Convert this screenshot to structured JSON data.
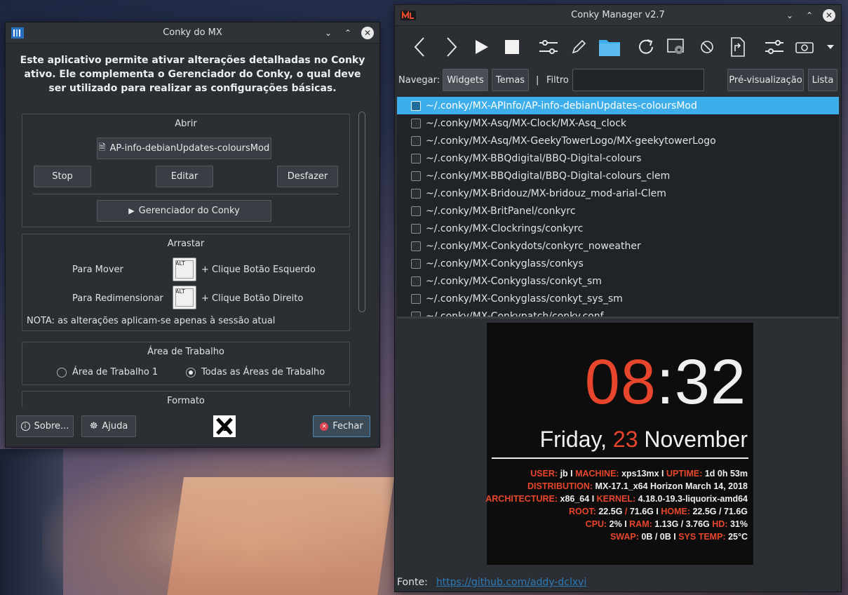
{
  "mx": {
    "title": "Conky do MX",
    "intro": "Este aplicativo permite ativar alterações detalhadas no Conky ativo. Ele complementa o Gerenciador do Conky, o qual deve ser utilizado para realizar as configurações básicas.",
    "abrir": {
      "title": "Abrir",
      "file_button": "AP-info-debianUpdates-coloursMod",
      "stop": "Stop",
      "editar": "Editar",
      "desfazer": "Desfazer",
      "manager_button": "Gerenciador do Conky"
    },
    "arrastar": {
      "title": "Arrastar",
      "mover_label": "Para Mover",
      "mover_action": "+ Clique Botão Esquerdo",
      "redim_label": "Para Redimensionar",
      "redim_action": "+ Clique Botão Direito",
      "key": "ALT",
      "note": "NOTA: as alterações aplicam-se apenas à sessão  atual"
    },
    "area": {
      "title": "Área de Trabalho",
      "opt1": "Área de Trabalho 1",
      "opt2": "Todas as Áreas de Trabalho",
      "selected": "opt2"
    },
    "formato": {
      "title": "Formato"
    },
    "footer": {
      "sobre": "Sobre...",
      "ajuda": "Ajuda",
      "fechar": "Fechar"
    }
  },
  "cm": {
    "title": "Conky Manager v2.7",
    "toolbar": [
      "back-icon",
      "forward-icon",
      "play-icon",
      "stop-icon",
      "settings-sliders-icon",
      "edit-pencil-icon",
      "folder-icon",
      "refresh-icon",
      "preview-gear-icon",
      "disable-icon",
      "export-icon",
      "options-sliders-icon",
      "camera-icon",
      "dropdown-arrow-icon"
    ],
    "nav": {
      "label": "Navegar:",
      "widgets": "Widgets",
      "temas": "Temas",
      "pipe": "|",
      "filtro": "Filtro",
      "filtro_value": "",
      "preview": "Pré-visualização",
      "lista": "Lista"
    },
    "widgets": [
      "~/.conky/MX-APInfo/AP-info-debianUpdates-coloursMod",
      "~/.conky/MX-Asq/MX-Clock/MX-Asq_clock",
      "~/.conky/MX-Asq/MX-GeekyTowerLogo/MX-geekytowerLogo",
      "~/.conky/MX-BBQdigital/BBQ-Digital-colours",
      "~/.conky/MX-BBQdigital/BBQ-Digital-colours_clem",
      "~/.conky/MX-Bridouz/MX-bridouz_mod-arial-Clem",
      "~/.conky/MX-BritPanel/conkyrc",
      "~/.conky/MX-Clockrings/conkyrc",
      "~/.conky/MX-Conkydots/conkyrc_noweather",
      "~/.conky/MX-Conkyglass/conkys",
      "~/.conky/MX-Conkyglass/conkyt_sm",
      "~/.conky/MX-Conkyglass/conkyt_sys_sm",
      "~/.conky/MX-Conkypatch/conky.conf"
    ],
    "selected_index": 0,
    "preview": {
      "hour": "08",
      "colon": ":",
      "minute": "32",
      "weekday": "Friday,",
      "day": "23",
      "month": "November",
      "lines": [
        [
          [
            "k",
            "USER: "
          ],
          [
            "v",
            "jb"
          ],
          [
            "v",
            " I "
          ],
          [
            "k",
            "MACHINE: "
          ],
          [
            "v",
            "xps13mx"
          ],
          [
            "v",
            " I "
          ],
          [
            "k",
            "UPTIME: "
          ],
          [
            "v",
            "1d 0h 53m"
          ]
        ],
        [
          [
            "k",
            "DISTRIBUTION: "
          ],
          [
            "v",
            "MX-17.1_x64 Horizon March 14, 2018"
          ]
        ],
        [
          [
            "k",
            "ARCHITECTURE: "
          ],
          [
            "v",
            "x86_64"
          ],
          [
            "v",
            " I "
          ],
          [
            "k",
            "KERNEL: "
          ],
          [
            "v",
            "4.18.0-19.3-liquorix-amd64"
          ]
        ],
        [
          [
            "k",
            "ROOT: "
          ],
          [
            "v",
            "22.5G "
          ],
          [
            "k",
            "/ "
          ],
          [
            "v",
            "71.6G"
          ],
          [
            "v",
            " I "
          ],
          [
            "k",
            "HOME: "
          ],
          [
            "v",
            "22.5G / 71.6G"
          ]
        ],
        [
          [
            "k",
            "CPU: "
          ],
          [
            "v",
            "2%"
          ],
          [
            "v",
            " I "
          ],
          [
            "k",
            "RAM: "
          ],
          [
            "v",
            "1.13G / 3.76G"
          ],
          [
            "v",
            " "
          ],
          [
            "k",
            "HD: "
          ],
          [
            "v",
            "31%"
          ]
        ],
        [
          [
            "k",
            "SWAP: "
          ],
          [
            "v",
            "0B / 0B"
          ],
          [
            "v",
            " I "
          ],
          [
            "k",
            "SYS TEMP: "
          ],
          [
            "v",
            "25°C"
          ]
        ]
      ],
      "accent": "#e8462c"
    },
    "footer": {
      "label": "Fonte:",
      "link": "https://github.com/addy-dclxvi"
    }
  }
}
